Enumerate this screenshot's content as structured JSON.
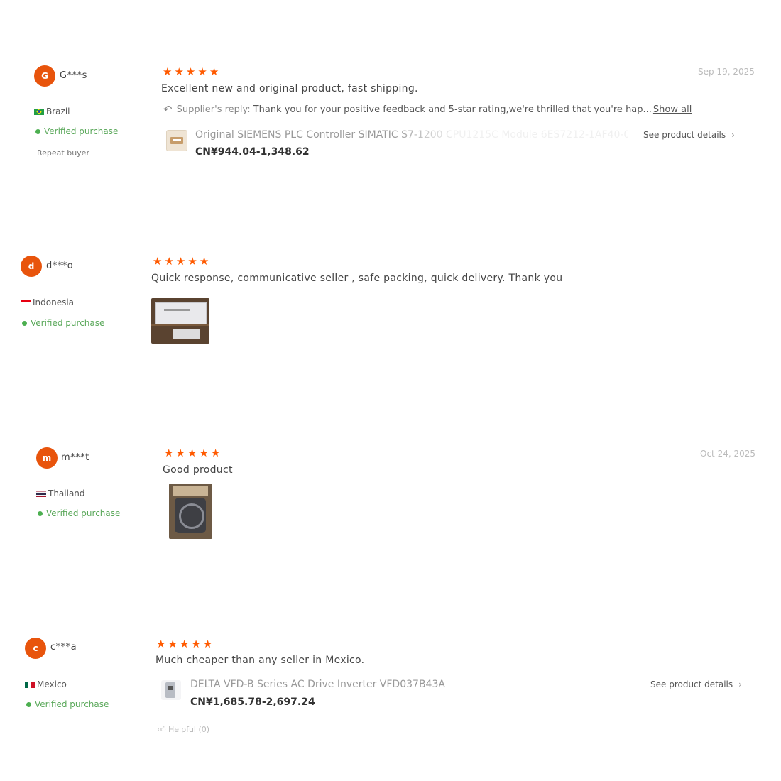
{
  "colors": {
    "accent": "#e8540c",
    "star": "#ff5a00",
    "verified": "#5aa85a"
  },
  "reviews": [
    {
      "avatar_letter": "G",
      "username": "G***s",
      "country": "Brazil",
      "verified": "Verified purchase",
      "repeat": "Repeat buyer",
      "stars": 5,
      "date": "Sep 19, 2025",
      "text": "Excellent new and original product, fast shipping.",
      "reply_label": "Supplier's reply:",
      "reply_text": "Thank you for your positive feedback and 5-star rating,we're thrilled that you're hap...",
      "reply_show_all": "Show all",
      "product_title": "Original SIEMENS PLC Controller SIMATIC S7-1200 CPU1215C Module 6ES7212-1AF40-0...",
      "product_price": "CN¥944.04-1,348.62",
      "see_details": "See product details",
      "photo_icon": "photo-thumbnail"
    },
    {
      "avatar_letter": "d",
      "username": "d***o",
      "country": "Indonesia",
      "verified": "Verified purchase",
      "stars": 5,
      "text": "Quick response, communicative seller , safe packing, quick delivery. Thank you",
      "photo_icon": "review-photo-box"
    },
    {
      "avatar_letter": "m",
      "username": "m***t",
      "country": "Thailand",
      "verified": "Verified purchase",
      "stars": 5,
      "date": "Oct 24, 2025",
      "text": "Good product",
      "photo_icon": "review-photo-cables"
    },
    {
      "avatar_letter": "c",
      "username": "c***a",
      "country": "Mexico",
      "verified": "Verified purchase",
      "stars": 5,
      "text": "Much cheaper than any seller in Mexico.",
      "product_title": "DELTA VFD-B Series AC Drive Inverter VFD037B43A",
      "product_price": "CN¥1,685.78-2,697.24",
      "see_details": "See product details",
      "helpful": "Helpful (0)"
    }
  ]
}
